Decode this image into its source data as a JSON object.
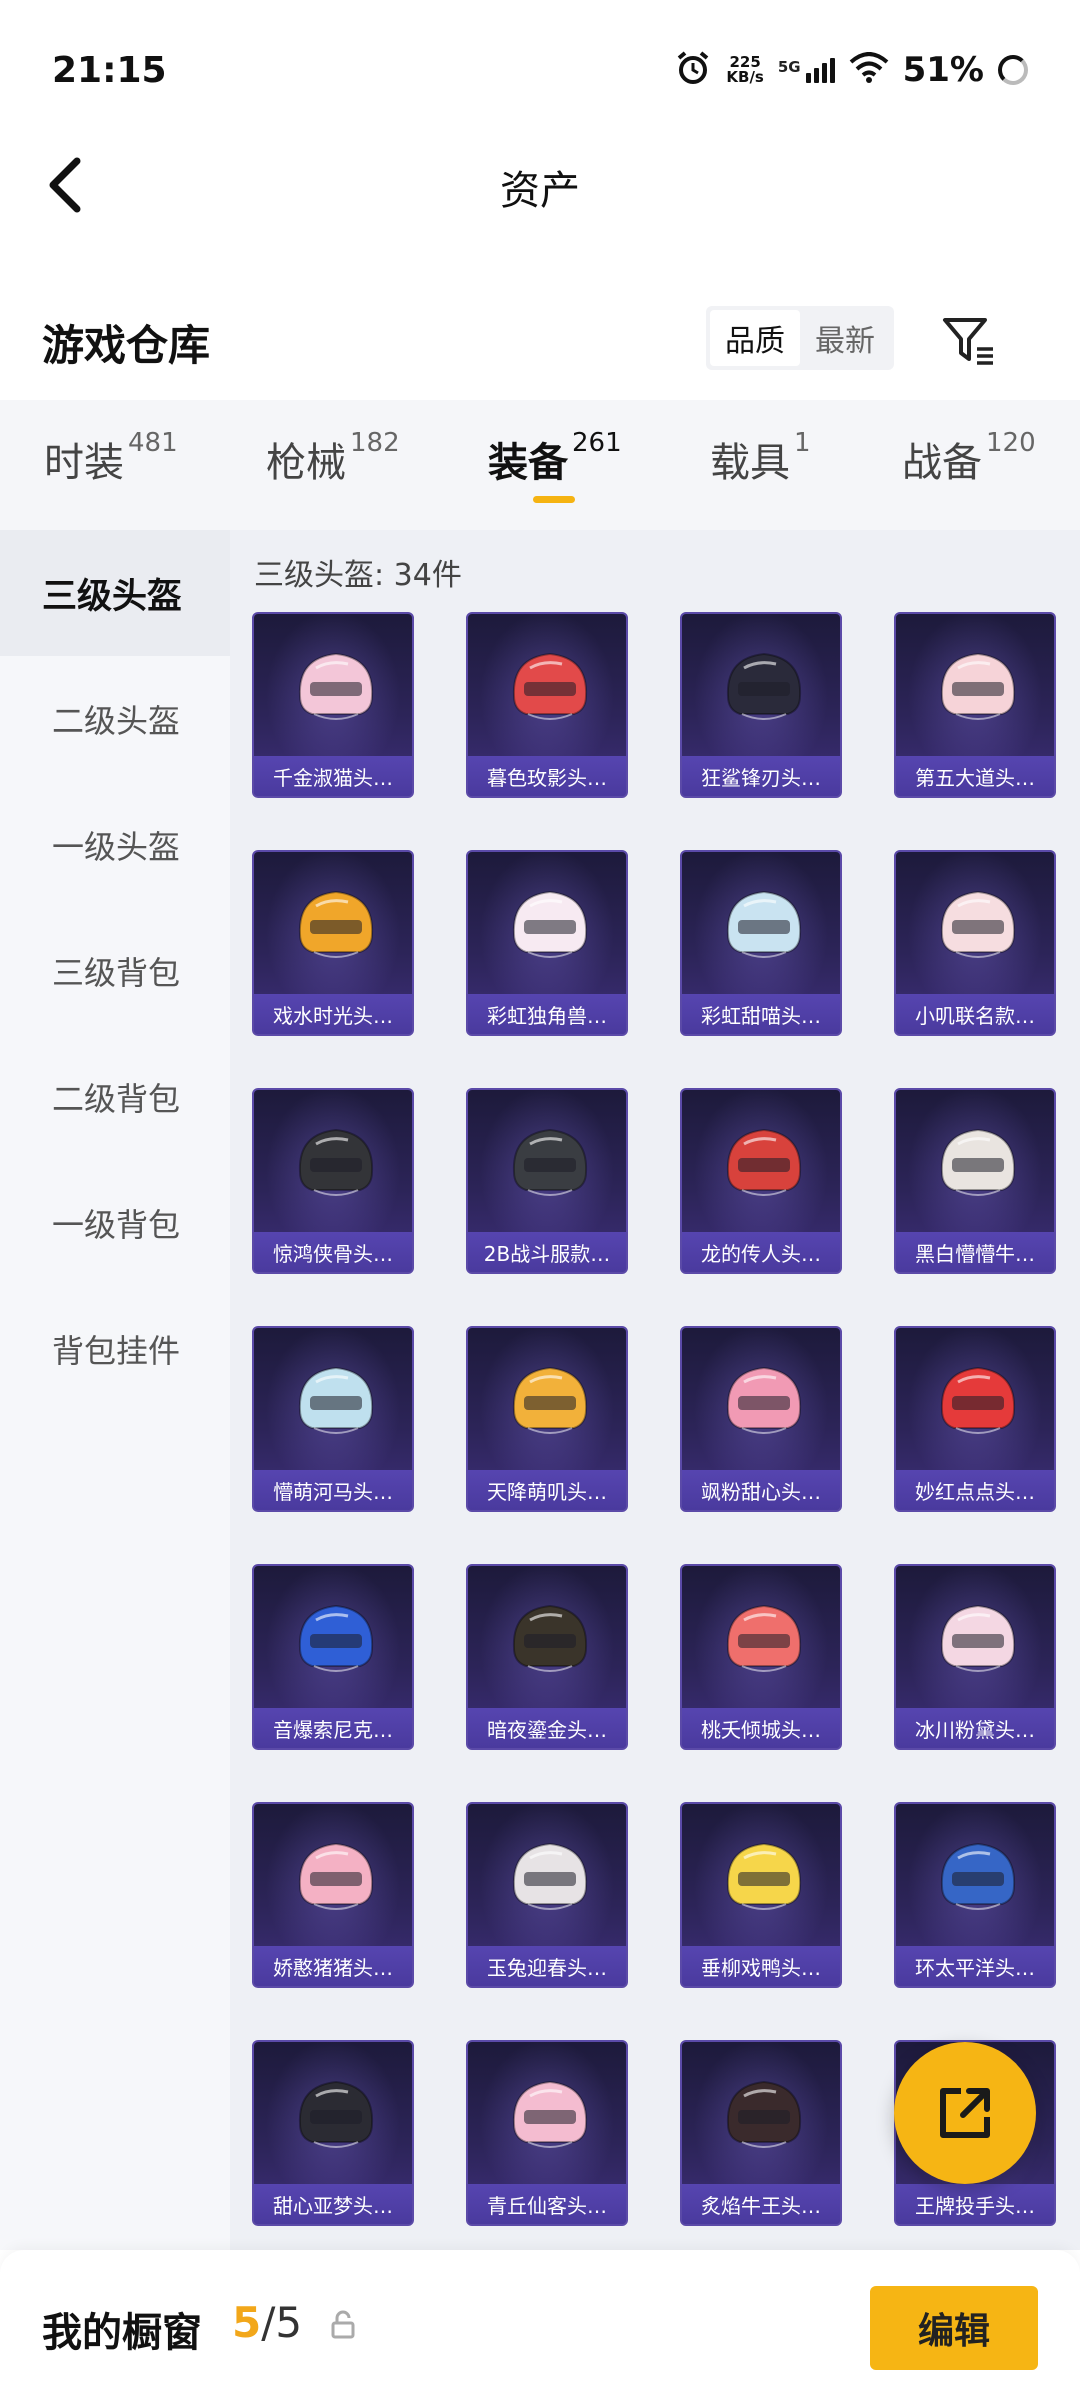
{
  "status_bar": {
    "time": "21:15",
    "net_speed_value": "225",
    "net_speed_unit": "KB/s",
    "network": "5G",
    "battery": "51%",
    "icons": [
      "alarm-icon",
      "signal-icon",
      "wifi-icon",
      "battery-icon"
    ]
  },
  "header": {
    "title": "资产",
    "back_icon": "chevron-left-icon"
  },
  "warehouse": {
    "title": "游戏仓库",
    "sort_options": [
      "品质",
      "最新"
    ],
    "sort_selected": "品质",
    "filter_icon": "filter-icon"
  },
  "categories": [
    {
      "label": "时装",
      "count": "481"
    },
    {
      "label": "枪械",
      "count": "182"
    },
    {
      "label": "装备",
      "count": "261",
      "active": true
    },
    {
      "label": "载具",
      "count": "1"
    },
    {
      "label": "战备",
      "count": "120"
    }
  ],
  "sidebar": {
    "items": [
      {
        "label": "三级头盔",
        "active": true
      },
      {
        "label": "二级头盔"
      },
      {
        "label": "一级头盔"
      },
      {
        "label": "三级背包"
      },
      {
        "label": "二级背包"
      },
      {
        "label": "一级背包"
      },
      {
        "label": "背包挂件"
      }
    ]
  },
  "grid": {
    "caption": "三级头盔: 34件",
    "items": [
      {
        "name": "千金淑猫头…",
        "color": "#f3c6d8"
      },
      {
        "name": "暮色玫影头…",
        "color": "#e24a4a"
      },
      {
        "name": "狂鲨锋刃头…",
        "color": "#2a2a3a"
      },
      {
        "name": "第五大道头…",
        "color": "#f6d3d8"
      },
      {
        "name": "戏水时光头…",
        "color": "#f0a62a"
      },
      {
        "name": "彩虹独角兽…",
        "color": "#f7eaf2"
      },
      {
        "name": "彩虹甜喵头…",
        "color": "#c9e3f1"
      },
      {
        "name": "小叽联名款…",
        "color": "#f6dde0"
      },
      {
        "name": "惊鸿侠骨头…",
        "color": "#333438"
      },
      {
        "name": "2B战斗服款…",
        "color": "#3a3d42"
      },
      {
        "name": "龙的传人头…",
        "color": "#d8423c"
      },
      {
        "name": "黑白懵懵牛…",
        "color": "#e9e4e0"
      },
      {
        "name": "懵萌河马头…",
        "color": "#bfe0ee"
      },
      {
        "name": "天降萌叽头…",
        "color": "#f2b13a"
      },
      {
        "name": "飒粉甜心头…",
        "color": "#f19ab4"
      },
      {
        "name": "妙红点点头…",
        "color": "#e53a3a"
      },
      {
        "name": "音爆索尼克…",
        "color": "#2f5fd6"
      },
      {
        "name": "暗夜鎏金头…",
        "color": "#3a342a"
      },
      {
        "name": "桃夭倾城头…",
        "color": "#ef6f6c"
      },
      {
        "name": "冰川粉黛头…",
        "color": "#f4d7e3"
      },
      {
        "name": "娇憨猪猪头…",
        "color": "#f4b1c4"
      },
      {
        "name": "玉兔迎春头…",
        "color": "#e7e3e5"
      },
      {
        "name": "垂柳戏鸭头…",
        "color": "#f6d64a"
      },
      {
        "name": "环太平洋头…",
        "color": "#3666c6"
      },
      {
        "name": "甜心亚梦头…",
        "color": "#2b2b33"
      },
      {
        "name": "青丘仙客头…",
        "color": "#f4bcd0"
      },
      {
        "name": "炙焰牛王头…",
        "color": "#3a2a2c"
      },
      {
        "name": "王牌投手头…",
        "color": "#2c4fb0"
      }
    ]
  },
  "fab": {
    "icon": "share-external-icon"
  },
  "bottom_bar": {
    "label": "我的橱窗",
    "current": "5",
    "separator": "/",
    "total": "5",
    "lock_icon": "lock-icon",
    "edit_label": "编辑"
  },
  "colors": {
    "accent": "#f6b514",
    "card_bg": "#2c2458",
    "card_label_bg": "#5645b0"
  }
}
